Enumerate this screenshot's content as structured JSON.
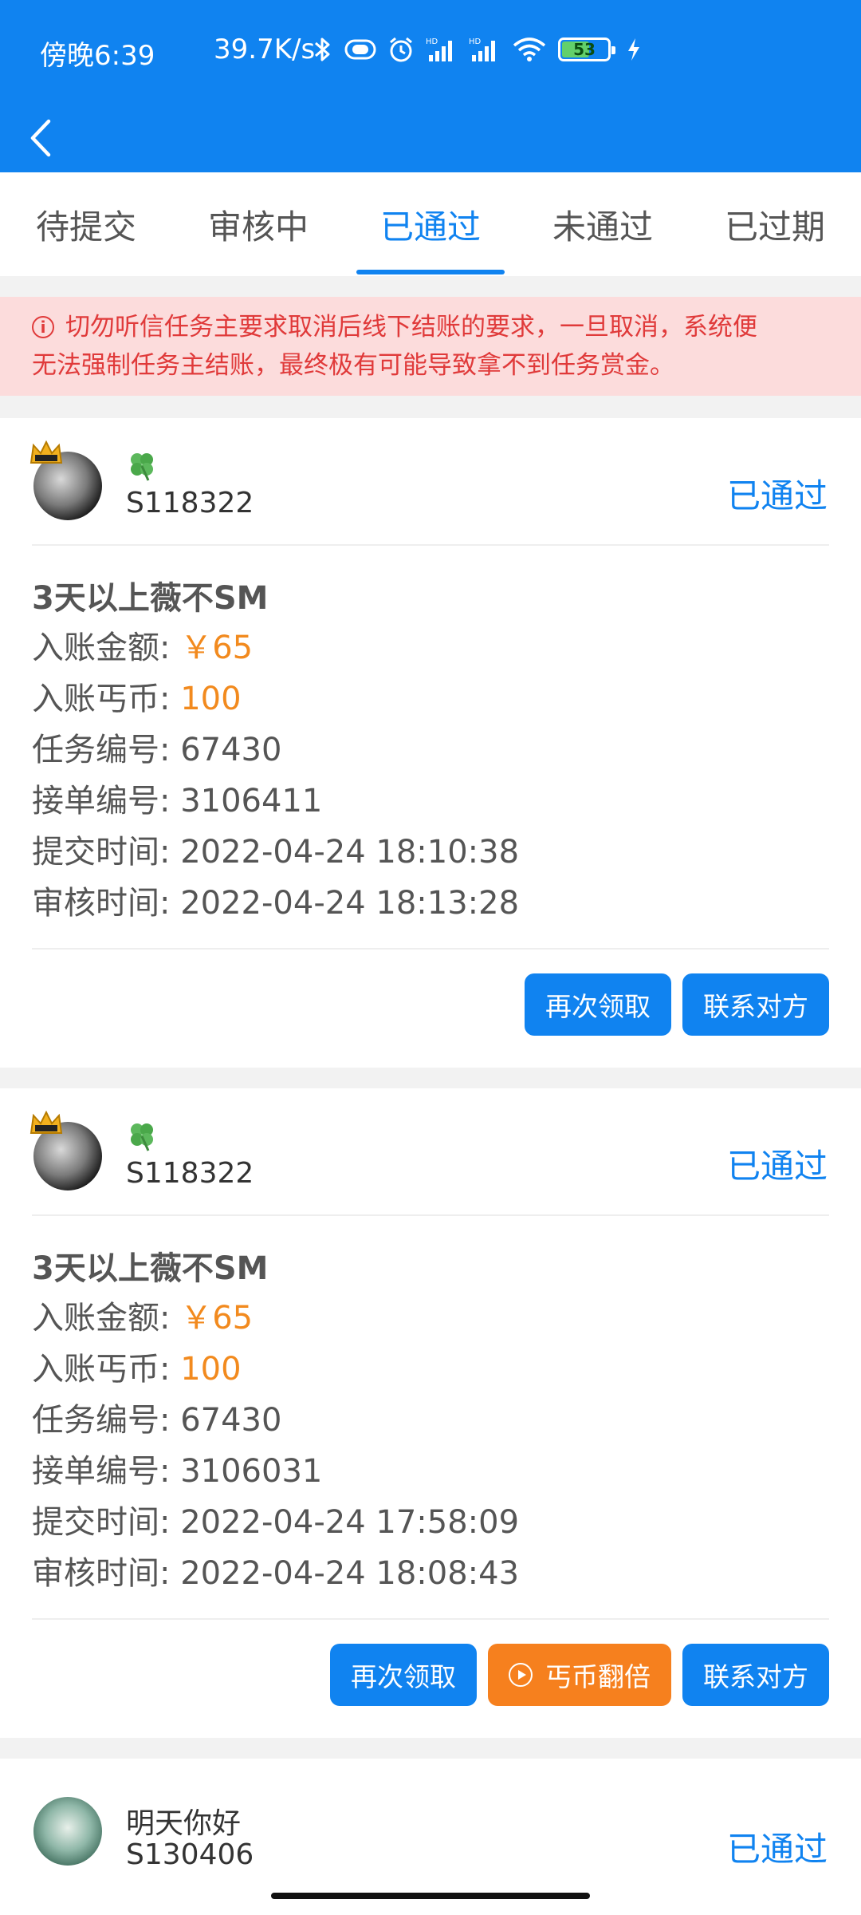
{
  "status_bar": {
    "time": "傍晚6:39",
    "net_speed": "39.7K/s",
    "battery": "53",
    "icons": [
      "bluetooth-icon",
      "vibrate-icon",
      "alarm-icon",
      "signal-hd-icon",
      "signal-hd-icon",
      "wifi-icon",
      "battery-icon",
      "charging-icon"
    ]
  },
  "tabs": [
    {
      "label": "待提交"
    },
    {
      "label": "审核中"
    },
    {
      "label": "已通过"
    },
    {
      "label": "未通过"
    },
    {
      "label": "已过期"
    }
  ],
  "active_tab": 2,
  "notice": {
    "line1": "切勿听信任务主要求取消后线下结账的要求，一旦取消，系统便",
    "line2": "无法强制任务主结账，最终极有可能导致拿不到任务赏金。"
  },
  "labels": {
    "amount": "入账金额: ",
    "coins": "入账丐币: ",
    "task_no": "任务编号: ",
    "order_no": "接单编号: ",
    "submit_time": "提交时间: ",
    "review_time": "审核时间: "
  },
  "cards": [
    {
      "user_id": "S118322",
      "status": "已通过",
      "title": "3天以上薇不SM",
      "amount": "￥65",
      "coins": "100",
      "task_no": "67430",
      "order_no": "3106411",
      "submit_time": "2022-04-24 18:10:38",
      "review_time": "2022-04-24 18:13:28",
      "buttons": {
        "reclaim": "再次领取",
        "contact": "联系对方"
      }
    },
    {
      "user_id": "S118322",
      "status": "已通过",
      "title": "3天以上薇不SM",
      "amount": "￥65",
      "coins": "100",
      "task_no": "67430",
      "order_no": "3106031",
      "submit_time": "2022-04-24 17:58:09",
      "review_time": "2022-04-24 18:08:43",
      "buttons": {
        "reclaim": "再次领取",
        "double": "丐币翻倍",
        "contact": "联系对方"
      }
    },
    {
      "user_name": "明天你好",
      "user_id": "S130406",
      "status": "已通过"
    }
  ],
  "colors": {
    "primary": "#1083f0",
    "orange": "#f28a1e",
    "notice_bg": "#fcdcdc",
    "notice_text": "#e03a3a"
  }
}
